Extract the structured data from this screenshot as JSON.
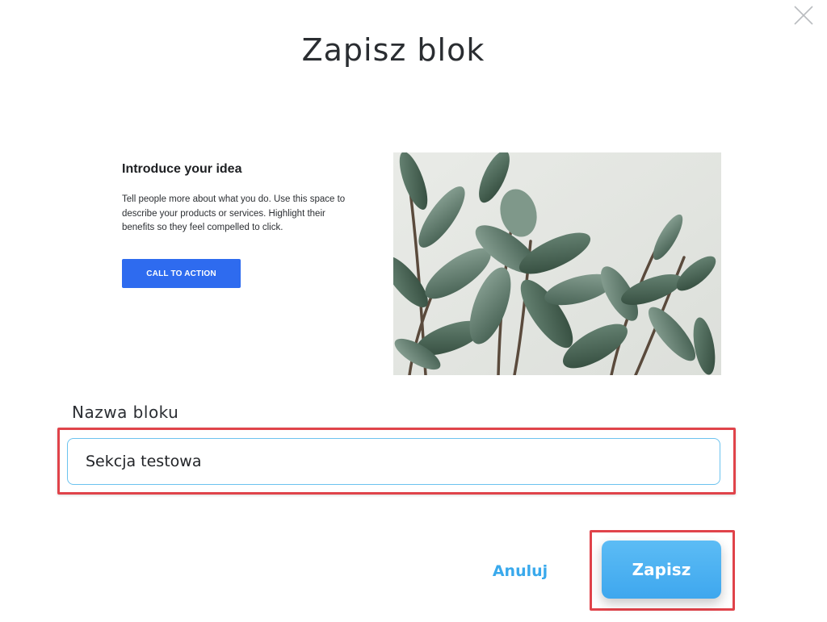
{
  "modal": {
    "title": "Zapisz blok",
    "close_icon": "close-icon"
  },
  "preview": {
    "heading": "Introduce your idea",
    "body": "Tell people more about what you do. Use this space to describe your products or services. Highlight their benefits so they feel compelled to click.",
    "cta_label": "CALL TO ACTION",
    "cta_color": "#2e6bef",
    "image_icon": "plant-image"
  },
  "form": {
    "label": "Nazwa bloku",
    "value": "Sekcja testowa"
  },
  "actions": {
    "cancel_label": "Anuluj",
    "save_label": "Zapisz",
    "accent_color": "#3ea7ee",
    "highlight_color": "#e0434a"
  }
}
